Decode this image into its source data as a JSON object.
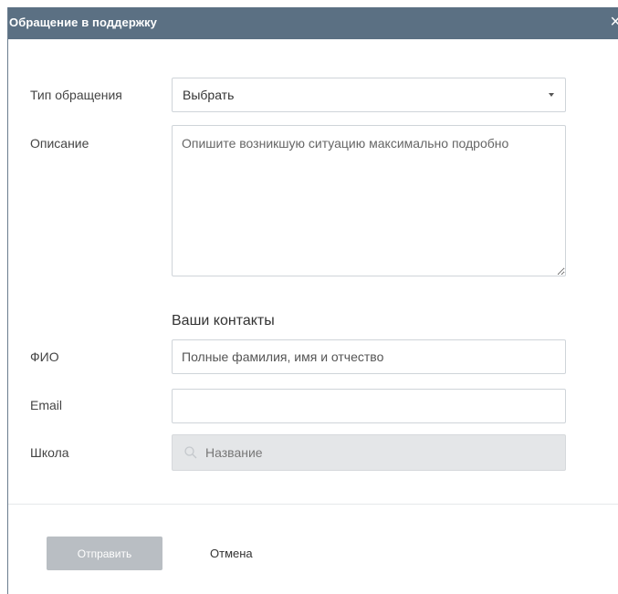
{
  "dialog": {
    "title": "Обращение в поддержку",
    "close_icon": "×"
  },
  "form": {
    "type_label": "Тип обращения",
    "type_value": "Выбрать",
    "description_label": "Описание",
    "description_placeholder": "Опишите возникшую ситуацию максимально подробно",
    "contacts_title": "Ваши контакты",
    "fio_label": "ФИО",
    "fio_placeholder": "Полные фамилия, имя и отчество",
    "email_label": "Email",
    "email_value": "",
    "school_label": "Школа",
    "school_placeholder": "Название"
  },
  "actions": {
    "submit_label": "Отправить",
    "cancel_label": "Отмена"
  },
  "colors": {
    "titlebar": "#5b7083",
    "submit_disabled": "#b9bec3"
  }
}
